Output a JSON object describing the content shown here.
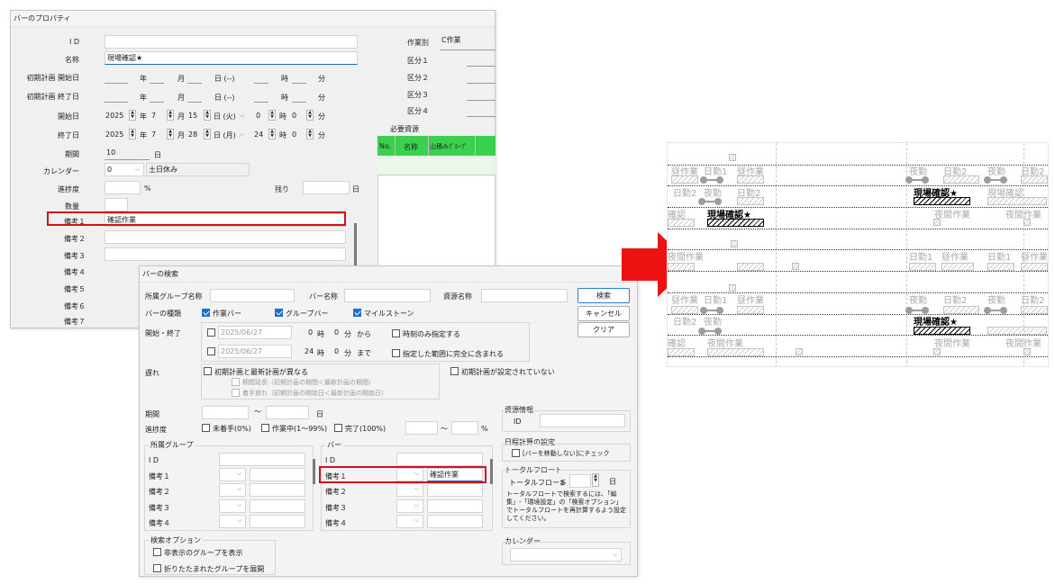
{
  "bar_properties": {
    "title": "バーのプロパティ",
    "labels": {
      "id": "I D",
      "name": "名称",
      "initial_start": "初期計画 開始日",
      "initial_end": "初期計画 終了日",
      "start": "開始日",
      "end": "終了日",
      "period": "期間",
      "calendar": "カレンダー",
      "progress": "進捗度",
      "quantity": "数量",
      "remarks1": "備考１",
      "remarks2": "備考２",
      "remarks3": "備考３",
      "remarks4": "備考４",
      "remarks5": "備考５",
      "remarks6": "備考６",
      "remarks7": "備考７",
      "remaining": "残り",
      "work_type": "作業別",
      "div1": "区分１",
      "div2": "区分２",
      "div3": "区分３",
      "div4": "区分４",
      "required_resources": "必要資源"
    },
    "values": {
      "name": "現場確認★",
      "start_year": "2025",
      "start_month": "7",
      "start_day": "15",
      "start_dow": "日 (火)",
      "start_hour": "0",
      "start_min": "0",
      "end_year": "2025",
      "end_month": "7",
      "end_day": "28",
      "end_dow": "日 (月)",
      "end_hour": "24",
      "end_min": "0",
      "period": "10",
      "calendar_code": "0",
      "calendar_name": "土日休み",
      "remarks1": "確認作業",
      "work_type": "C作業"
    },
    "units": {
      "year": "年",
      "month": "月",
      "day_blank": "日 (--)",
      "day": "日",
      "hour": "時",
      "minute": "分",
      "percent": "%"
    },
    "resource_table": {
      "headers": [
        "No.",
        "名称",
        "山積みｸﾞﾙｰﾌﾟ"
      ]
    }
  },
  "bar_search": {
    "title": "バーの検索",
    "labels": {
      "group_name": "所属グループ名称",
      "bar_name": "バー名称",
      "resource_name": "資源名称",
      "bar_kind": "バーの種類",
      "start_end": "開始・終了",
      "delay": "遅れ",
      "period": "期間",
      "progress": "進捗度",
      "group_section": "所属グループ",
      "bar_section": "バー",
      "id": "I D",
      "remarks1": "備考１",
      "remarks2": "備考２",
      "remarks3": "備考３",
      "remarks4": "備考４",
      "search_options": "検索オプション",
      "resource_info": "資源情報",
      "resource_id": "ID",
      "schedule_calc": "日程計算の設定",
      "total_float": "トータルフロート",
      "total_float_field": "トータルフロート",
      "calendar": "カレンダー"
    },
    "checkboxes": {
      "work_bar": "作業バー",
      "group_bar": "グループバー",
      "milestone": "マイルストーン",
      "time_only": "時刻のみ指定する",
      "fully_within": "指定した範囲に完全に含まれる",
      "initial_differs": "初期計画と最新計画が異なる",
      "period_extend": "期間延長（初期計画の期間＜最新計画の期間）",
      "start_delay": "着手遅れ（初期計画の開始日＜最新計画の開始日）",
      "initial_unset": "初期計画が設定されていない",
      "not_started": "未着手(0%)",
      "in_progress": "作業中(1〜99%)",
      "completed": "完了(100%)",
      "show_hidden": "非表示のグループを表示",
      "expand_collapsed": "折りたたまれたグループを展開",
      "no_move": "[バーを移動しない]にチェック"
    },
    "date_from": "2025/06/27",
    "date_to": "2025/06/27",
    "time_from_h": "0",
    "time_from_m": "0",
    "time_to_h": "24",
    "time_to_m": "0",
    "units": {
      "hour": "時",
      "minute": "分",
      "from": "から",
      "to": "まで",
      "tilde": "〜",
      "day": "日",
      "percent": "%",
      "le": "≦"
    },
    "remarks1_value": "確認作業",
    "float_note": "トータルフロートで検索するには、「編集」-「環境設定」の「検索オプション」でトータルフロートを再計算するよう設定してください。",
    "buttons": {
      "search": "検索",
      "cancel": "キャンセル",
      "clear": "クリア"
    }
  },
  "gantt": {
    "highlight_label": "現場確認★",
    "row_labels": {
      "r1": [
        "昼作業",
        "日勤1",
        "昼作業",
        "夜勤",
        "日勤2",
        "夜勤",
        "日勤2"
      ],
      "r2": [
        "日勤2",
        "夜勤",
        "日勤2",
        "現場確認"
      ],
      "r3": [
        "確認",
        "夜間作業",
        "夜間作業"
      ],
      "r4": [
        "夜間作業",
        "日勤1",
        "昼作業",
        "日勤1",
        "昼作業"
      ]
    },
    "colors": {
      "arrow": "#ee1111",
      "highlight_border": "#d0121b"
    }
  }
}
